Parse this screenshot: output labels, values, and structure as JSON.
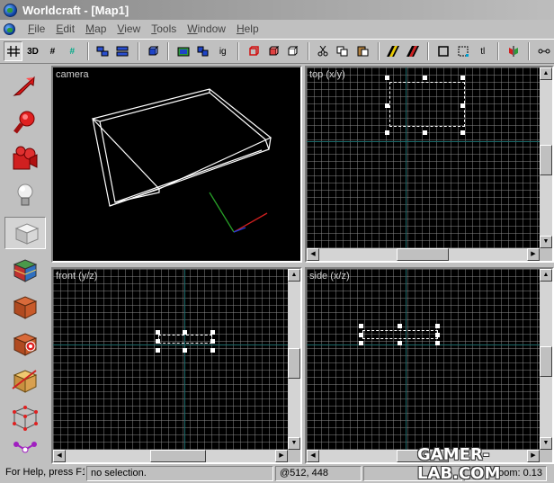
{
  "window": {
    "title": "Worldcraft - [Map1]"
  },
  "menu": [
    "File",
    "Edit",
    "Map",
    "View",
    "Tools",
    "Window",
    "Help"
  ],
  "toolbar": [
    {
      "icon": "grid-icon",
      "label": "",
      "pressed": true
    },
    {
      "icon": "3d-grid-icon",
      "label": "3D",
      "pressed": false
    },
    {
      "icon": "smaller-grid-icon",
      "label": "#",
      "pressed": false
    },
    {
      "icon": "larger-grid-icon",
      "label": "#",
      "pressed": false
    },
    {
      "icon": "animate-icon",
      "label": "",
      "pressed": false
    },
    {
      "icon": "load-window-state-icon",
      "label": "",
      "pressed": false
    },
    {
      "icon": "save-window-state-icon",
      "label": "",
      "pressed": false
    },
    {
      "icon": "group-icon",
      "label": "",
      "pressed": false
    },
    {
      "icon": "ungroup-icon",
      "label": "",
      "pressed": false
    },
    {
      "icon": "hide-icon",
      "label": "",
      "pressed": false
    },
    {
      "icon": "ignore-group-icon",
      "label": "ig",
      "pressed": false
    },
    {
      "icon": "carve-icon",
      "label": "",
      "pressed": false
    },
    {
      "icon": "hollow-icon",
      "label": "",
      "pressed": false
    },
    {
      "icon": "paste-special-icon",
      "label": "",
      "pressed": false
    },
    {
      "icon": "cut-icon",
      "label": "",
      "pressed": false
    },
    {
      "icon": "copy-icon",
      "label": "",
      "pressed": false
    },
    {
      "icon": "paste-icon",
      "label": "",
      "pressed": false
    },
    {
      "icon": "texture-lock-icon",
      "label": "",
      "pressed": false
    },
    {
      "icon": "texture-scale-lock-icon",
      "label": "",
      "pressed": false
    },
    {
      "icon": "select-icon",
      "label": "",
      "pressed": false
    },
    {
      "icon": "handles-icon",
      "label": "",
      "pressed": false
    },
    {
      "icon": "tl-icon",
      "label": "tl",
      "pressed": false
    },
    {
      "icon": "flip-icon",
      "label": "",
      "pressed": false
    },
    {
      "icon": "tie-icon",
      "label": "",
      "pressed": false
    }
  ],
  "tools": [
    {
      "name": "selection-tool",
      "icon": "arrow-icon",
      "pressed": false
    },
    {
      "name": "magnify-tool",
      "icon": "magnifier-icon",
      "pressed": false
    },
    {
      "name": "camera-tool",
      "icon": "camera-icon",
      "pressed": false
    },
    {
      "name": "entity-tool",
      "icon": "light-bulb-icon",
      "pressed": false
    },
    {
      "name": "block-tool",
      "icon": "cube-icon",
      "pressed": true
    },
    {
      "name": "texture-application-tool",
      "icon": "textured-cube-icon",
      "pressed": false
    },
    {
      "name": "apply-texture-tool",
      "icon": "crate-icon",
      "pressed": false
    },
    {
      "name": "decal-tool",
      "icon": "target-crate-icon",
      "pressed": false
    },
    {
      "name": "clipping-tool",
      "icon": "clip-cube-icon",
      "pressed": false
    },
    {
      "name": "vertex-tool",
      "icon": "vertex-cube-icon",
      "pressed": false
    },
    {
      "name": "path-tool",
      "icon": "path-icon",
      "pressed": false
    }
  ],
  "views": {
    "camera": "camera",
    "top": "top (x/y)",
    "front": "front (y/z)",
    "side": "side (x/z)"
  },
  "status": {
    "help": "For Help, press F1",
    "selection": "no selection.",
    "coords": "@512, 448",
    "zoom": "Zoom: 0.13"
  },
  "watermark": "GAMER-LAB.COM",
  "colors": {
    "titlebar": "#a8a8a8",
    "grid": "#7a7a7a",
    "axis": "#1c6b6b",
    "viewport_bg": "#000000"
  }
}
